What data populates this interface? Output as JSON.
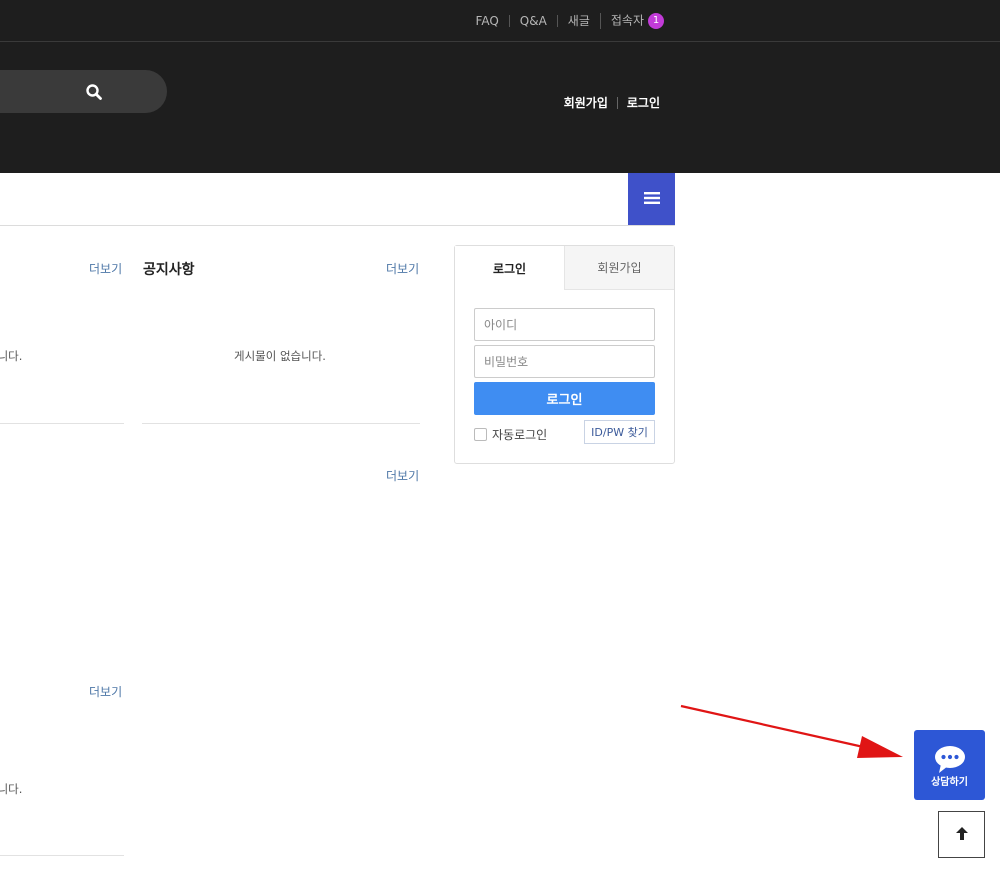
{
  "topbar": {
    "links": [
      "FAQ",
      "Q&A",
      "새글",
      "접속자"
    ],
    "visitor_count": "1"
  },
  "header": {
    "search": {
      "placeholder": "",
      "icon": "search-icon"
    },
    "user_links": [
      "회원가입",
      "로그인"
    ]
  },
  "nav": {
    "menu_icon": "hamburger-icon"
  },
  "boards": {
    "more_label": "더보기",
    "notice_title": "공지사항",
    "empty_text": "게시물이 없습니다.",
    "empty_text_cut": "습니다."
  },
  "login": {
    "tabs": [
      "로그인",
      "회원가입"
    ],
    "id_placeholder": "아이디",
    "pw_placeholder": "비밀번호",
    "submit_label": "로그인",
    "auto_login_label": "자동로그인",
    "find_label": "ID/PW 찾기"
  },
  "floating": {
    "chat_label": "상담하기",
    "chat_icon": "chat-bubble-icon",
    "top_icon": "arrow-up-icon"
  },
  "colors": {
    "dark_bg": "#1e1e1e",
    "menu_blue": "#3f51c9",
    "login_blue": "#3f8df2",
    "chat_blue": "#2d57d6",
    "badge_purple": "#c23bd8",
    "arrow_red": "#e01515"
  }
}
